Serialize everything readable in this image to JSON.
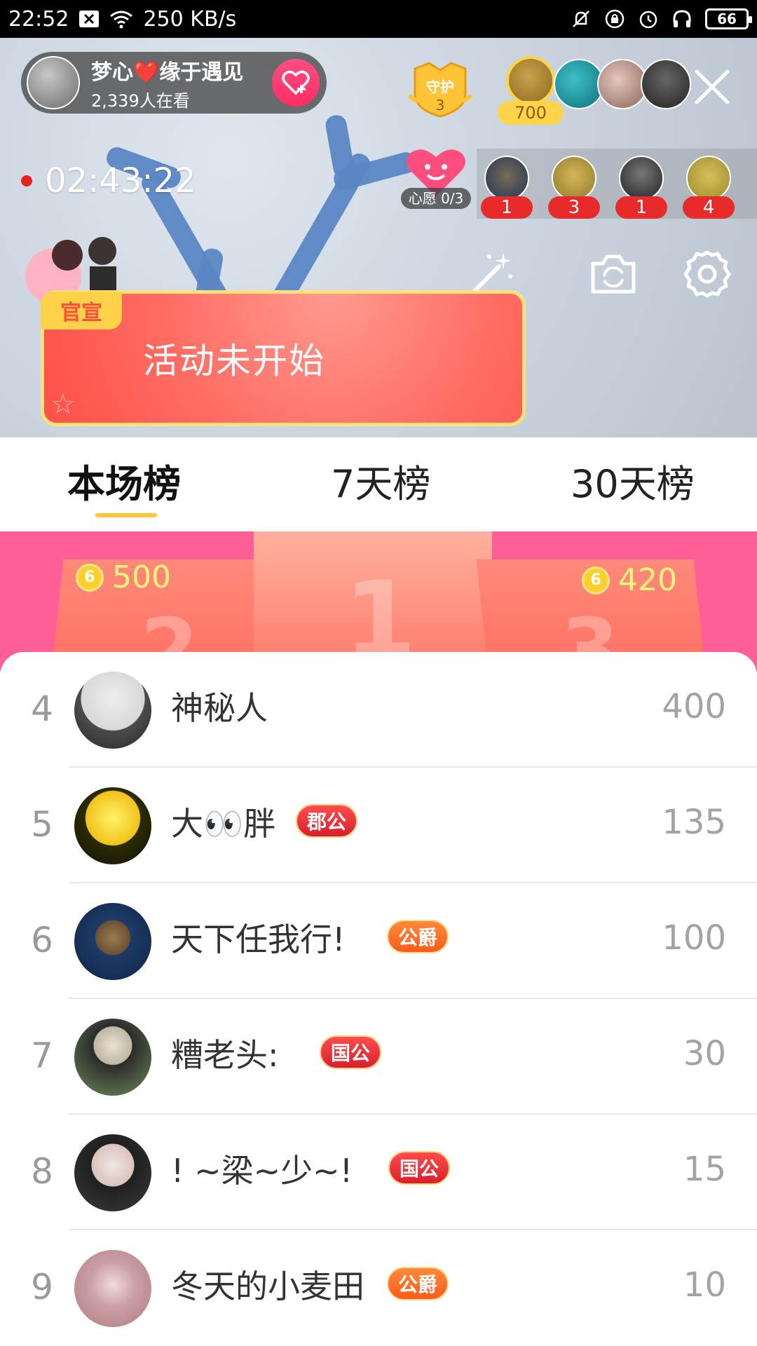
{
  "status_bar": {
    "time": "22:52",
    "net_speed": "250 KB/s",
    "battery": "66",
    "icons": [
      "notification-x-icon",
      "wifi-icon",
      "mute-icon",
      "lock-rotation-icon",
      "alarm-icon",
      "headphones-icon",
      "battery-icon"
    ]
  },
  "live": {
    "host_name": "梦心❤️缘于遇见",
    "viewers": "2,339人在看",
    "guard_label": "守护",
    "guard_count": "3",
    "top_fan_score": "700",
    "elapsed": "02:43:22",
    "wish_label": "心愿 0/3",
    "rank_strip": [
      {
        "count": "1"
      },
      {
        "count": "3"
      },
      {
        "count": "1"
      },
      {
        "count": "4"
      }
    ],
    "activity_tag": "官宣",
    "activity_text": "活动未开始"
  },
  "tabs": [
    {
      "label": "本场榜",
      "active": true
    },
    {
      "label": "7天榜",
      "active": false
    },
    {
      "label": "30天榜",
      "active": false
    }
  ],
  "podium": {
    "second_score": "500",
    "third_score": "420",
    "first_label": "1",
    "second_label": "2",
    "third_label": "3"
  },
  "leaderboard": [
    {
      "rank": "4",
      "name": "神秘人",
      "badge": "",
      "score": "400"
    },
    {
      "rank": "5",
      "name": "大👀胖",
      "badge": "郡公",
      "score": "135"
    },
    {
      "rank": "6",
      "name": "天下任我行!",
      "badge": "公爵",
      "score": "100"
    },
    {
      "rank": "7",
      "name": "糟老头:",
      "badge": "国公",
      "score": "30"
    },
    {
      "rank": "8",
      "name": "! ~梁~少~!",
      "badge": "国公",
      "score": "15"
    },
    {
      "rank": "9",
      "name": "冬天的小麦田",
      "badge": "公爵",
      "score": "10"
    }
  ],
  "colors": {
    "accent_tab_underline": "#ffc83a",
    "podium_bg": "#ff5f96",
    "banner_red": "#ff5047",
    "badge_red": "#d81f2c",
    "badge_orange": "#ff5a1c"
  }
}
